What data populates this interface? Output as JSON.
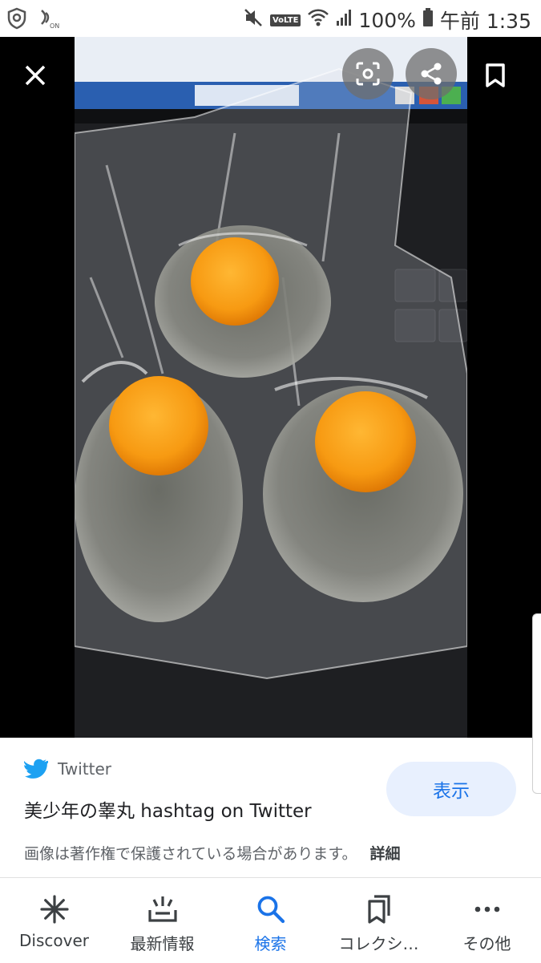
{
  "status_bar": {
    "battery_percent": "100%",
    "time": "午前 1:35",
    "icons": [
      "shield-icon",
      "nfc-icon",
      "mute-icon",
      "volte-icon",
      "wifi-icon",
      "signal-icon",
      "battery-icon"
    ],
    "volte_label": "VoLTE"
  },
  "viewer": {
    "close_icon": "close-icon",
    "lens_icon": "lens-icon",
    "share_icon": "share-icon",
    "bookmark_icon": "bookmark-icon"
  },
  "result": {
    "source_name": "Twitter",
    "title": "美少年の睾丸 hashtag on Twitter",
    "view_button": "表示",
    "notice": "画像は著作権で保護されている場合があります。",
    "notice_link": "詳細"
  },
  "bottom_nav": {
    "items": [
      {
        "label": "Discover",
        "icon": "asterisk-icon"
      },
      {
        "label": "最新情報",
        "icon": "updates-icon"
      },
      {
        "label": "検索",
        "icon": "search-icon",
        "active": true
      },
      {
        "label": "コレクシ…",
        "icon": "collections-icon"
      },
      {
        "label": "その他",
        "icon": "more-icon"
      }
    ]
  },
  "colors": {
    "accent": "#1a73e8",
    "button_bg": "#e8f0fe",
    "twitter_blue": "#1da1f2"
  }
}
